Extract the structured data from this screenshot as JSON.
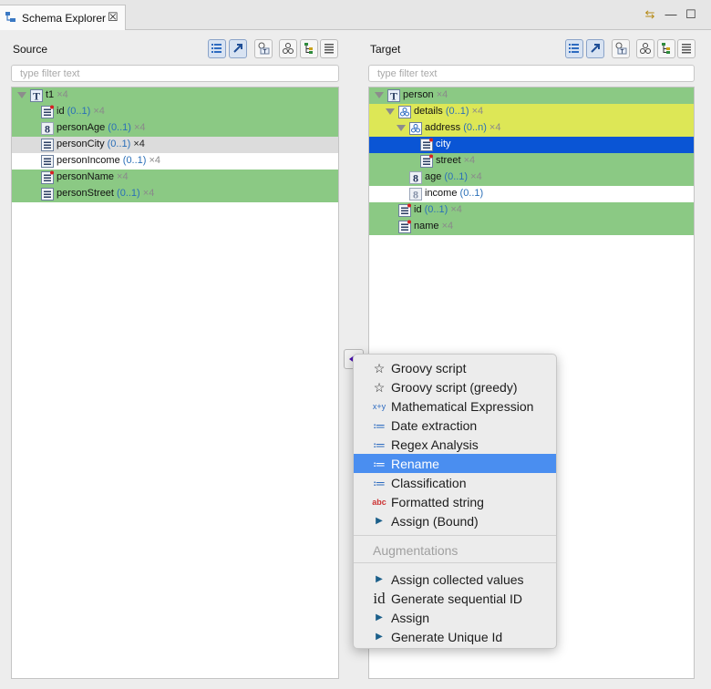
{
  "window": {
    "tab_title": "Schema Explorer",
    "tab_icon": "schema-explorer-icon",
    "close_glyph": "☒",
    "buttons": [
      {
        "name": "link-icon",
        "glyph": "⇆"
      },
      {
        "name": "minimize-icon",
        "glyph": "—"
      },
      {
        "name": "maximize-icon",
        "glyph": "☐"
      }
    ]
  },
  "source": {
    "label": "Source",
    "filter_placeholder": "type filter text",
    "rows": [
      {
        "indent": 0,
        "icon": "type",
        "name": "t1",
        "card": "",
        "mult": " ×4",
        "bg": "green",
        "expanded": true
      },
      {
        "indent": 1,
        "icon": "property-required",
        "name": "id",
        "card": " (0..1)",
        "mult": " ×4",
        "bg": "green"
      },
      {
        "indent": 1,
        "icon": "number",
        "name": "personAge",
        "card": " (0..1)",
        "mult": " ×4",
        "bg": "green"
      },
      {
        "indent": 1,
        "icon": "property",
        "name": "personCity",
        "card": " (0..1)",
        "mult": " ×4",
        "bg": "gray"
      },
      {
        "indent": 1,
        "icon": "property",
        "name": "personIncome",
        "card": " (0..1)",
        "mult": " ×4",
        "bg": "white"
      },
      {
        "indent": 1,
        "icon": "property-required",
        "name": "personName",
        "card": "",
        "mult": " ×4",
        "bg": "green"
      },
      {
        "indent": 1,
        "icon": "property",
        "name": "personStreet",
        "card": " (0..1)",
        "mult": " ×4",
        "bg": "green"
      }
    ]
  },
  "target": {
    "label": "Target",
    "filter_placeholder": "type filter text",
    "rows": [
      {
        "indent": 0,
        "icon": "type",
        "name": "person",
        "card": "",
        "mult": " ×4",
        "bg": "green",
        "expanded": true
      },
      {
        "indent": 1,
        "icon": "group",
        "name": "details",
        "card": " (0..1)",
        "mult": " ×4",
        "bg": "yellow",
        "expanded": true
      },
      {
        "indent": 2,
        "icon": "group",
        "name": "address",
        "card": " (0..n)",
        "mult": " ×4",
        "bg": "yellow",
        "expanded": true
      },
      {
        "indent": 3,
        "icon": "property-required",
        "name": "city",
        "card": "",
        "mult": "",
        "bg": "selected"
      },
      {
        "indent": 3,
        "icon": "property-required",
        "name": "street",
        "card": "",
        "mult": " ×4",
        "bg": "green"
      },
      {
        "indent": 2,
        "icon": "number",
        "name": "age",
        "card": " (0..1)",
        "mult": " ×4",
        "bg": "green"
      },
      {
        "indent": 2,
        "icon": "number-light",
        "name": "income",
        "card": " (0..1)",
        "mult": "",
        "bg": "white"
      },
      {
        "indent": 1,
        "icon": "property-required",
        "name": "id",
        "card": " (0..1)",
        "mult": " ×4",
        "bg": "green"
      },
      {
        "indent": 1,
        "icon": "property-required",
        "name": "name",
        "card": "",
        "mult": " ×4",
        "bg": "green"
      }
    ]
  },
  "toolbar_icons": [
    "list-view-icon",
    "arrow-icon",
    "type-filter-icon",
    "group-icon",
    "tree-icon",
    "properties-icon"
  ],
  "context_menu": {
    "items": [
      {
        "label": "Groovy script",
        "icon": "star-icon",
        "glyph": "☆"
      },
      {
        "label": "Groovy script (greedy)",
        "icon": "star-icon",
        "glyph": "☆"
      },
      {
        "label": "Mathematical Expression",
        "icon": "formula-icon",
        "glyph": "x+y"
      },
      {
        "label": "Date extraction",
        "icon": "list-icon",
        "glyph": "≔"
      },
      {
        "label": "Regex Analysis",
        "icon": "list-icon",
        "glyph": "≔"
      },
      {
        "label": "Rename",
        "icon": "list-icon",
        "glyph": "≔",
        "highlighted": true
      },
      {
        "label": "Classification",
        "icon": "list-icon",
        "glyph": "≔"
      },
      {
        "label": "Formatted string",
        "icon": "abc-icon",
        "glyph": "abc"
      },
      {
        "label": "Assign (Bound)",
        "icon": "assign-arrow-icon",
        "glyph": "▶"
      }
    ],
    "section_header": "Augmentations",
    "aug_items": [
      {
        "label": "Assign collected values",
        "icon": "assign-arrow-icon",
        "glyph": "▶"
      },
      {
        "label": "Generate sequential ID",
        "icon": "id-icon",
        "glyph": "id"
      },
      {
        "label": "Assign",
        "icon": "assign-arrow-icon",
        "glyph": "▶"
      },
      {
        "label": "Generate Unique Id",
        "icon": "assign-arrow-icon",
        "glyph": "▶"
      }
    ]
  },
  "colors": {
    "match_green": "#8bc984",
    "partial_yellow": "#dde756",
    "selection_blue": "#0a55d5",
    "menu_highlight": "#4a8ef0",
    "cardinality_blue": "#2a6fb8"
  }
}
